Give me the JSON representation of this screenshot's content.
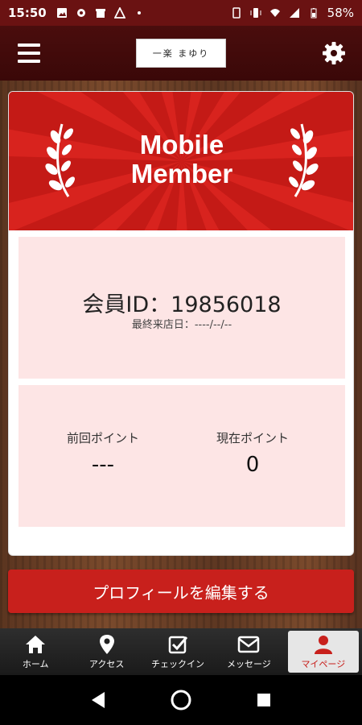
{
  "status": {
    "time": "15:50",
    "battery": "58%"
  },
  "header": {
    "logo_text": "一楽 まゆり"
  },
  "banner": {
    "title_line1": "Mobile",
    "title_line2": "Member"
  },
  "member": {
    "id_text": "会員ID：19856018",
    "last_visit": "最終来店日：----/--/--"
  },
  "points": {
    "previous_label": "前回ポイント",
    "previous_value": "---",
    "current_label": "現在ポイント",
    "current_value": "0"
  },
  "edit_button": "プロフィールを編集する",
  "tabs": [
    {
      "label": "ホーム",
      "icon": "home-icon"
    },
    {
      "label": "アクセス",
      "icon": "map-pin-icon"
    },
    {
      "label": "チェックイン",
      "icon": "checkin-icon"
    },
    {
      "label": "メッセージ",
      "icon": "mail-icon"
    },
    {
      "label": "マイページ",
      "icon": "user-icon"
    }
  ],
  "colors": {
    "accent": "#d8231e",
    "panel": "#fde5e5",
    "header": "#4a0d0d"
  }
}
